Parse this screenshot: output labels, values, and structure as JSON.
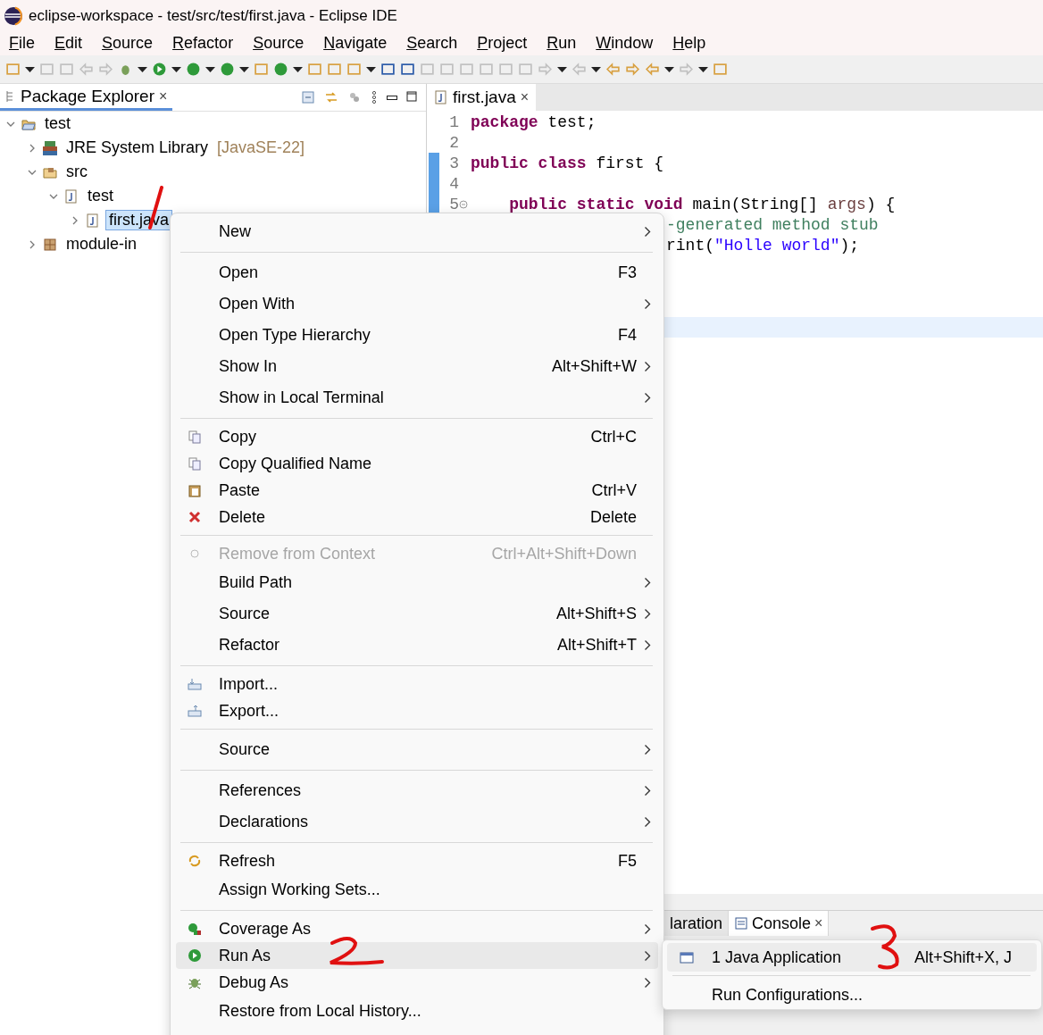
{
  "window": {
    "title": "eclipse-workspace - test/src/test/first.java - Eclipse IDE"
  },
  "menu_bar": [
    "File",
    "Edit",
    "Source",
    "Refactor",
    "Source",
    "Navigate",
    "Search",
    "Project",
    "Run",
    "Window",
    "Help"
  ],
  "package_explorer": {
    "tab": {
      "label": "Package Explorer",
      "close": "×",
      "selected": true
    },
    "tree": [
      {
        "label": "test",
        "expanded": true,
        "selected": false,
        "children": [
          {
            "label": "JRE System Library",
            "decoration": "[JavaSE-22]",
            "expanded": false,
            "selected": false
          },
          {
            "label": "src",
            "expanded": true,
            "selected": false,
            "children": [
              {
                "label": "test",
                "expanded": true,
                "selected": false,
                "children": [
                  {
                    "label": "first.java",
                    "expanded": false,
                    "selected": true
                  }
                ]
              }
            ]
          },
          {
            "label": "module-in",
            "expanded": false,
            "selected": false
          }
        ]
      }
    ]
  },
  "editor": {
    "tab": {
      "label": "first.java",
      "close": "×",
      "selected": true
    },
    "lines": [
      {
        "number": "1",
        "changed": false,
        "current": false,
        "tokens": [
          {
            "kind": "keyword",
            "text": "package"
          },
          {
            "kind": "plain",
            "text": " test;"
          }
        ]
      },
      {
        "number": "2",
        "changed": false,
        "current": false
      },
      {
        "number": "3",
        "changed": true,
        "current": false,
        "tokens": [
          {
            "kind": "keyword",
            "text": "public class"
          },
          {
            "kind": "plain",
            "text": " first {"
          }
        ]
      },
      {
        "number": "4",
        "changed": true,
        "current": false
      },
      {
        "number": "5",
        "changed": true,
        "current": false,
        "fold": true,
        "tokens": [
          {
            "kind": "keyword",
            "text": "    public static void"
          },
          {
            "kind": "plain",
            "text": " main(String[] "
          },
          {
            "kind": "param",
            "text": "args"
          },
          {
            "kind": "plain",
            "text": ") {"
          }
        ]
      },
      {
        "current": false,
        "tokens": [
          {
            "kind": "comment",
            "text": "-generated method stub"
          }
        ]
      },
      {
        "current": false,
        "tokens": [
          {
            "kind": "plain",
            "text": "rint("
          },
          {
            "kind": "string",
            "text": "\"Holle world\""
          },
          {
            "kind": "plain",
            "text": ");"
          }
        ]
      },
      {
        "current": false
      },
      {
        "current": false
      },
      {
        "current": false
      },
      {
        "current": true
      }
    ]
  },
  "bottom_panel": {
    "tabs": [
      {
        "label": "laration",
        "selected": false
      },
      {
        "label": "Console",
        "close": "×",
        "selected": true
      }
    ]
  },
  "context_menu": {
    "items": [
      {
        "kind": "item",
        "label": "New",
        "submenu": true,
        "icon": false,
        "disabled": false,
        "selected": false
      },
      {
        "kind": "separator"
      },
      {
        "kind": "item",
        "label": "Open",
        "shortcut": "F3",
        "submenu": false,
        "icon": false,
        "disabled": false,
        "selected": false
      },
      {
        "kind": "item",
        "label": "Open With",
        "submenu": true,
        "icon": false,
        "disabled": false,
        "selected": false
      },
      {
        "kind": "item",
        "label": "Open Type Hierarchy",
        "shortcut": "F4",
        "submenu": false,
        "icon": false,
        "disabled": false,
        "selected": false
      },
      {
        "kind": "item",
        "label": "Show In",
        "shortcut": "Alt+Shift+W",
        "submenu": true,
        "icon": false,
        "disabled": false,
        "selected": false
      },
      {
        "kind": "item",
        "label": "Show in Local Terminal",
        "submenu": true,
        "icon": false,
        "disabled": false,
        "selected": false
      },
      {
        "kind": "separator"
      },
      {
        "kind": "item",
        "label": "Copy",
        "shortcut": "Ctrl+C",
        "submenu": false,
        "icon": true,
        "disabled": false,
        "selected": false
      },
      {
        "kind": "item",
        "label": "Copy Qualified Name",
        "submenu": false,
        "icon": true,
        "disabled": false,
        "selected": false
      },
      {
        "kind": "item",
        "label": "Paste",
        "shortcut": "Ctrl+V",
        "submenu": false,
        "icon": true,
        "disabled": false,
        "selected": false
      },
      {
        "kind": "item",
        "label": "Delete",
        "shortcut": "Delete",
        "submenu": false,
        "icon": true,
        "disabled": false,
        "selected": false
      },
      {
        "kind": "separator"
      },
      {
        "kind": "item",
        "label": "Remove from Context",
        "shortcut": "Ctrl+Alt+Shift+Down",
        "submenu": false,
        "icon": true,
        "disabled": true,
        "selected": false
      },
      {
        "kind": "item",
        "label": "Build Path",
        "submenu": true,
        "icon": false,
        "disabled": false,
        "selected": false
      },
      {
        "kind": "item",
        "label": "Source",
        "shortcut": "Alt+Shift+S",
        "submenu": true,
        "icon": false,
        "disabled": false,
        "selected": false
      },
      {
        "kind": "item",
        "label": "Refactor",
        "shortcut": "Alt+Shift+T",
        "submenu": true,
        "icon": false,
        "disabled": false,
        "selected": false
      },
      {
        "kind": "separator"
      },
      {
        "kind": "item",
        "label": "Import...",
        "submenu": false,
        "icon": true,
        "disabled": false,
        "selected": false
      },
      {
        "kind": "item",
        "label": "Export...",
        "submenu": false,
        "icon": true,
        "disabled": false,
        "selected": false
      },
      {
        "kind": "separator"
      },
      {
        "kind": "item",
        "label": "Source",
        "submenu": true,
        "icon": false,
        "disabled": false,
        "selected": false
      },
      {
        "kind": "separator"
      },
      {
        "kind": "item",
        "label": "References",
        "submenu": true,
        "icon": false,
        "disabled": false,
        "selected": false
      },
      {
        "kind": "item",
        "label": "Declarations",
        "submenu": true,
        "icon": false,
        "disabled": false,
        "selected": false
      },
      {
        "kind": "separator"
      },
      {
        "kind": "item",
        "label": "Refresh",
        "shortcut": "F5",
        "submenu": false,
        "icon": true,
        "disabled": false,
        "selected": false
      },
      {
        "kind": "item",
        "label": "Assign Working Sets...",
        "submenu": false,
        "icon": false,
        "disabled": false,
        "selected": false
      },
      {
        "kind": "separator"
      },
      {
        "kind": "item",
        "label": "Coverage As",
        "submenu": true,
        "icon": true,
        "disabled": false,
        "selected": false
      },
      {
        "kind": "item",
        "label": "Run As",
        "submenu": true,
        "icon": true,
        "disabled": false,
        "selected": true
      },
      {
        "kind": "item",
        "label": "Debug As",
        "submenu": true,
        "icon": true,
        "disabled": false,
        "selected": false
      },
      {
        "kind": "item",
        "label": "Restore from Local History...",
        "submenu": false,
        "icon": false,
        "disabled": false,
        "selected": false
      }
    ]
  },
  "submenu": {
    "items": [
      {
        "kind": "item",
        "label": "1 Java Application",
        "shortcut": "Alt+Shift+X, J",
        "icon": true,
        "selected": true
      },
      {
        "kind": "separator"
      },
      {
        "kind": "item",
        "label": "Run Configurations...",
        "icon": false,
        "selected": false
      }
    ]
  }
}
